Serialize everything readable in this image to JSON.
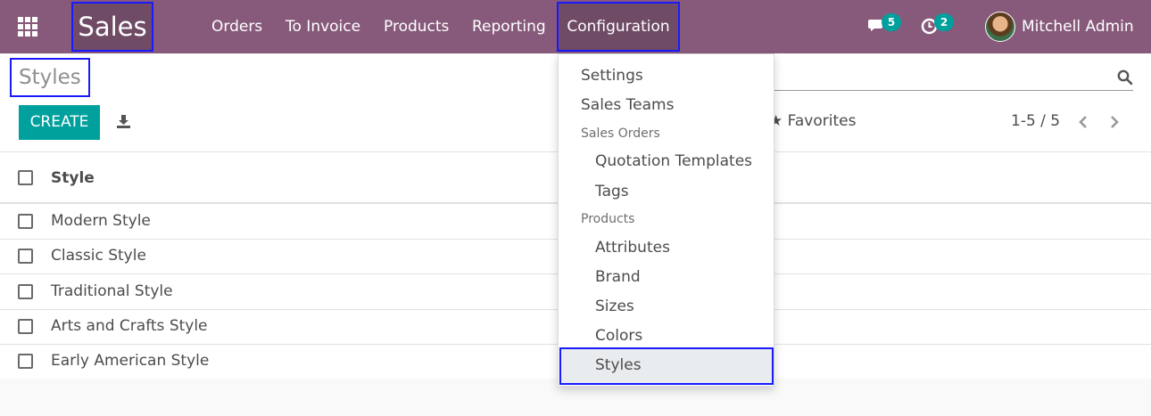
{
  "navbar": {
    "app_name": "Sales",
    "menu": {
      "orders": "Orders",
      "to_invoice": "To Invoice",
      "products": "Products",
      "reporting": "Reporting",
      "configuration": "Configuration"
    },
    "messages_count": "5",
    "activities_count": "2",
    "user_name": "Mitchell Admin",
    "colors": {
      "bar": "#875a7b",
      "badge": "#00a09d"
    }
  },
  "control_panel": {
    "title": "Styles",
    "create_label": "CREATE",
    "favorites_label": "Favorites",
    "pager": "1-5 / 5"
  },
  "table": {
    "column_header": "Style",
    "rows": [
      "Modern Style",
      "Classic Style",
      "Traditional Style",
      "Arts and Crafts Style",
      "Early American Style"
    ]
  },
  "dropdown": {
    "settings": "Settings",
    "sales_teams": "Sales Teams",
    "section_sales_orders": "Sales Orders",
    "quotation_templates": "Quotation Templates",
    "tags": "Tags",
    "section_products": "Products",
    "attributes": "Attributes",
    "brand": "Brand",
    "sizes": "Sizes",
    "colors": "Colors",
    "styles": "Styles"
  },
  "icons": {
    "apps": "apps-grid-icon",
    "messages": "chat-icon",
    "activities": "clock-icon",
    "search": "search-icon",
    "download": "download-icon",
    "favorites": "star-icon",
    "prev": "chevron-left-icon",
    "next": "chevron-right-icon"
  }
}
